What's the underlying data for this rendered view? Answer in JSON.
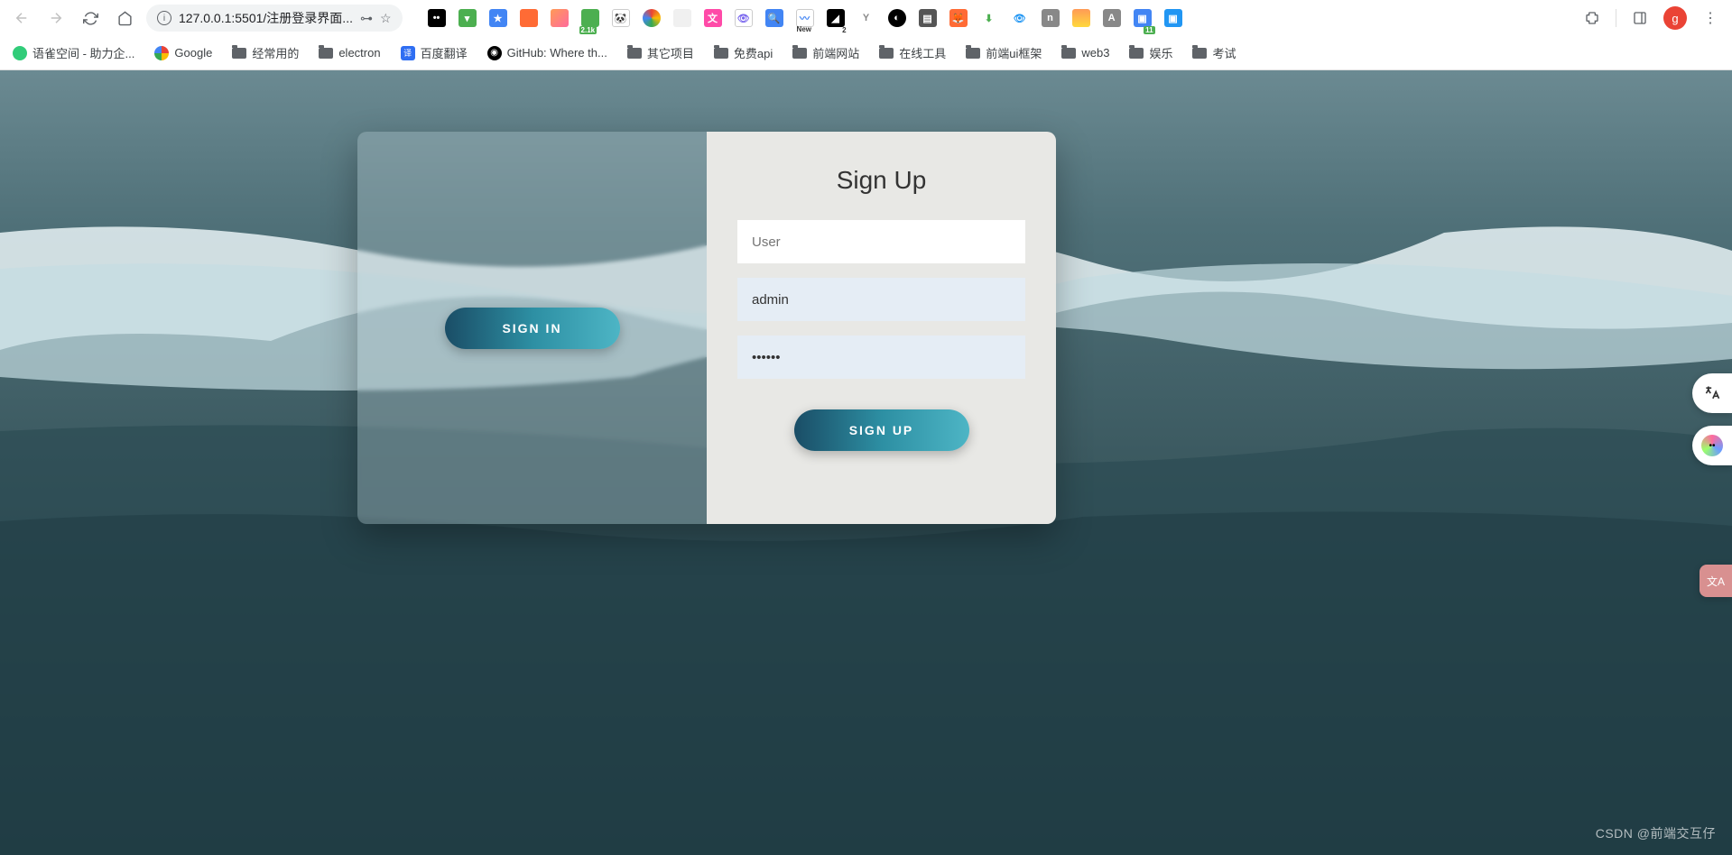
{
  "browser": {
    "url": "127.0.0.1:5501/注册登录界面...",
    "bookmarks": [
      {
        "label": "语雀空间 - 助力企...",
        "icon": "yuque",
        "color": "#31cc79"
      },
      {
        "label": "Google",
        "icon": "google",
        "color": "#4285f4"
      },
      {
        "label": "经常用的",
        "icon": "folder"
      },
      {
        "label": "electron",
        "icon": "folder"
      },
      {
        "label": "百度翻译",
        "icon": "baidu",
        "color": "#2f6ef2"
      },
      {
        "label": "GitHub: Where th...",
        "icon": "github",
        "color": "#000"
      },
      {
        "label": "其它项目",
        "icon": "folder"
      },
      {
        "label": "免费api",
        "icon": "folder"
      },
      {
        "label": "前端网站",
        "icon": "folder"
      },
      {
        "label": "在线工具",
        "icon": "folder"
      },
      {
        "label": "前端ui框架",
        "icon": "folder"
      },
      {
        "label": "web3",
        "icon": "folder"
      },
      {
        "label": "娱乐",
        "icon": "folder"
      },
      {
        "label": "考试",
        "icon": "folder"
      }
    ],
    "avatar_letter": "g",
    "ext_badge1": "2.1k",
    "ext_badge2": "New",
    "ext_badge3": "2",
    "ext_badge4": "11"
  },
  "form": {
    "title": "Sign Up",
    "signin_label": "SIGN IN",
    "signup_label": "SIGN UP",
    "user_placeholder": "User",
    "username_value": "admin",
    "password_value": "••••••"
  },
  "watermark": "CSDN @前端交互仔"
}
